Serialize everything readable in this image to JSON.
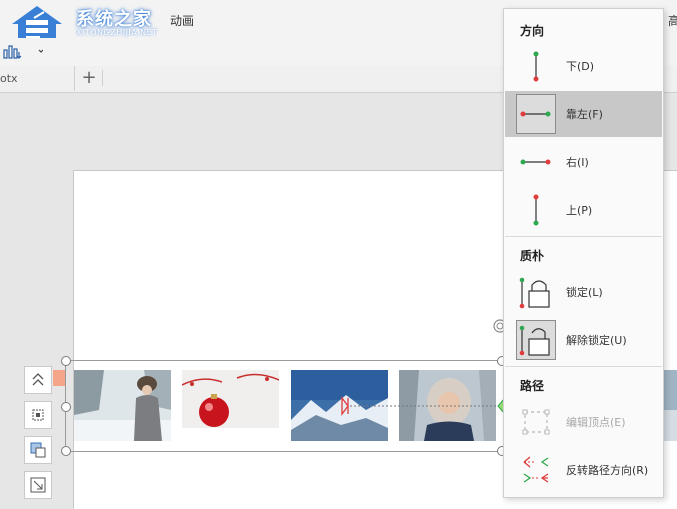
{
  "watermark": {
    "title": "系统之家",
    "subtitle": "XITONGZHIJIA.NET"
  },
  "ribbon": {
    "tab_animation": "动画",
    "tab_right_cut": "高"
  },
  "tabs": {
    "file_tab_label": "otx",
    "add_tab_symbol": "+"
  },
  "menu": {
    "section_direction": "方向",
    "item_down": "下(D)",
    "item_left": "靠左(F)",
    "item_right": "右(I)",
    "item_up": "上(P)",
    "section_texture": "质朴",
    "item_lock": "锁定(L)",
    "item_unlock": "解除锁定(U)",
    "section_path": "路径",
    "item_edit_points": "编辑顶点(E)",
    "item_reverse_path": "反转路径方向(R)"
  },
  "colors": {
    "accent_green": "#2fa84f",
    "accent_red": "#e03c3c",
    "selected_item_bg": "#c8c8c8",
    "logo_blue": "#3a7fd6"
  },
  "icons": {
    "direction_down": "vertical-line-green-top-red-bottom",
    "direction_left": "horizontal-line-red-left-green-right",
    "direction_right": "horizontal-line-green-left-red-right",
    "direction_up": "vertical-line-red-top-green-bottom",
    "lock": "padlock-closed",
    "unlock": "padlock-open",
    "edit_points": "dashed-square-vertices",
    "reverse_path": "reverse-arrows"
  }
}
